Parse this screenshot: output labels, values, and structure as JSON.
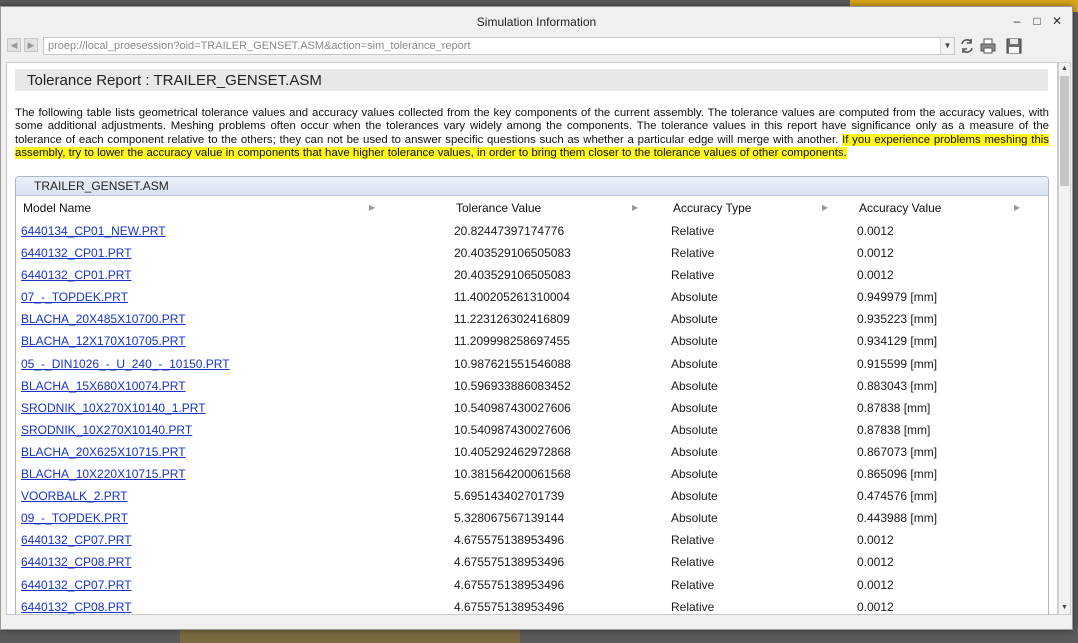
{
  "window": {
    "title": "Simulation Information"
  },
  "address": {
    "url": "proep://local_proesession?oid=TRAILER_GENSET.ASM&action=sim_tolerance_report"
  },
  "report": {
    "title": "Tolerance Report : TRAILER_GENSET.ASM",
    "description_plain": "The following table lists geometrical tolerance values and accuracy values collected from the key components of the current assembly. The tolerance values are computed from the accuracy values, with some additional adjustments. Meshing problems often occur when the tolerances vary widely among the components. The tolerance values in this report have significance only as a measure of the tolerance of each component relative to the others; they can not be used to answer specific questions such as whether a particular edge will merge with another. ",
    "description_highlight": "If you experience problems meshing this assembly, try to lower the accuracy value in components that have higher tolerance values, in order to bring them closer to the tolerance values of other components."
  },
  "table": {
    "panel_title": "TRAILER_GENSET.ASM",
    "columns": [
      "Model Name",
      "Tolerance Value",
      "Accuracy Type",
      "Accuracy Value"
    ],
    "rows": [
      [
        "6440134_CP01_NEW.PRT",
        "20.82447397174776",
        "Relative",
        "0.0012"
      ],
      [
        "6440132_CP01.PRT",
        "20.403529106505083",
        "Relative",
        "0.0012"
      ],
      [
        "6440132_CP01.PRT",
        "20.403529106505083",
        "Relative",
        "0.0012"
      ],
      [
        "07_-_TOPDEK.PRT",
        "11.400205261310004",
        "Absolute",
        "0.949979 [mm]"
      ],
      [
        "BLACHA_20X485X10700.PRT",
        "11.223126302416809",
        "Absolute",
        "0.935223 [mm]"
      ],
      [
        "BLACHA_12X170X10705.PRT",
        "11.209998258697455",
        "Absolute",
        "0.934129 [mm]"
      ],
      [
        "05_-_DIN1026_-_U_240_-_10150.PRT",
        "10.987621551546088",
        "Absolute",
        "0.915599 [mm]"
      ],
      [
        "BLACHA_15X680X10074.PRT",
        "10.596933886083452",
        "Absolute",
        "0.883043 [mm]"
      ],
      [
        "SRODNIK_10X270X10140_1.PRT",
        "10.540987430027606",
        "Absolute",
        "0.87838 [mm]"
      ],
      [
        "SRODNIK_10X270X10140.PRT",
        "10.540987430027606",
        "Absolute",
        "0.87838 [mm]"
      ],
      [
        "BLACHA_20X625X10715.PRT",
        "10.405292462972868",
        "Absolute",
        "0.867073 [mm]"
      ],
      [
        "BLACHA_10X220X10715.PRT",
        "10.381564200061568",
        "Absolute",
        "0.865096 [mm]"
      ],
      [
        "VOORBALK_2.PRT",
        "5.695143402701739",
        "Absolute",
        "0.474576 [mm]"
      ],
      [
        "09_-_TOPDEK.PRT",
        "5.328067567139144",
        "Absolute",
        "0.443988 [mm]"
      ],
      [
        "6440132_CP07.PRT",
        "4.675575138953496",
        "Relative",
        "0.0012"
      ],
      [
        "6440132_CP08.PRT",
        "4.675575138953496",
        "Relative",
        "0.0012"
      ],
      [
        "6440132_CP07.PRT",
        "4.675575138953496",
        "Relative",
        "0.0012"
      ],
      [
        "6440132_CP08.PRT",
        "4.675575138953496",
        "Relative",
        "0.0012"
      ]
    ]
  },
  "icons": {
    "back": "back-arrow-icon",
    "forward": "forward-arrow-icon",
    "refresh": "refresh-icon",
    "print": "printer-icon",
    "save": "save-disk-icon",
    "sort": "sort-arrow-icon"
  },
  "colors": {
    "link": "#1a33c7",
    "highlight": "#fff71e",
    "panel_header": "#dfe8f5"
  }
}
